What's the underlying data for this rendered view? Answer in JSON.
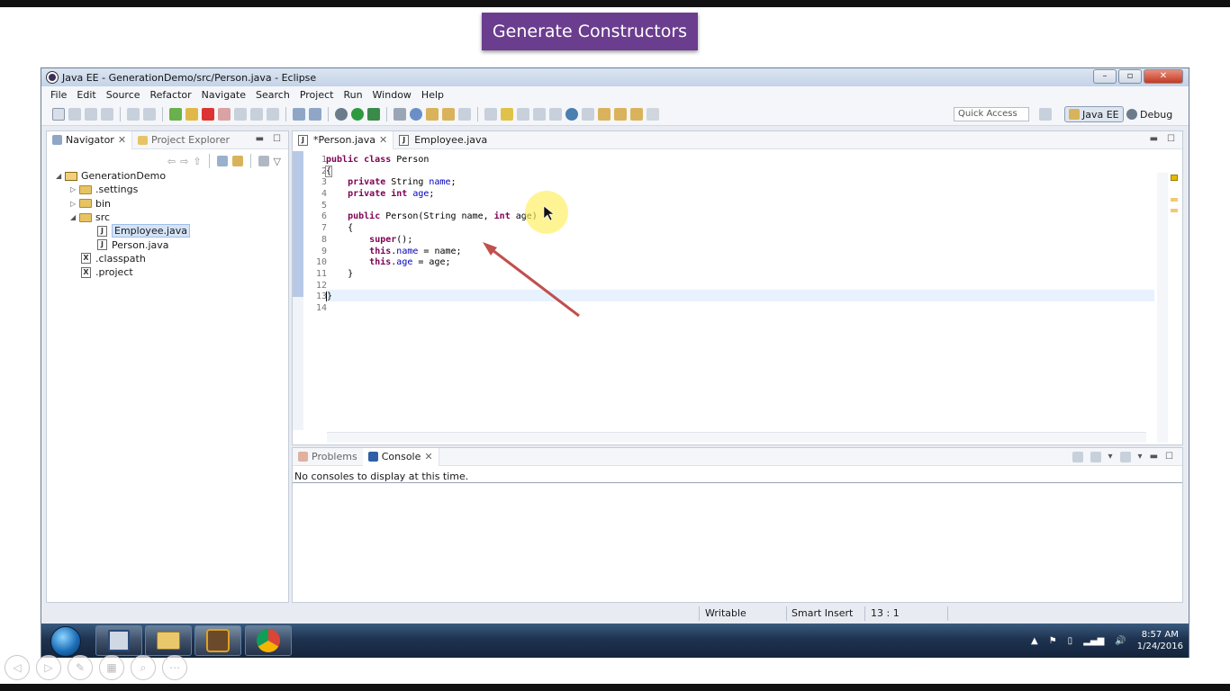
{
  "slide": {
    "title": "Generate Constructors"
  },
  "window": {
    "title": "Java EE - GenerationDemo/src/Person.java - Eclipse",
    "controls": {
      "minimize": "–",
      "maximize": "▫",
      "close": "✕"
    }
  },
  "menu": [
    "File",
    "Edit",
    "Source",
    "Refactor",
    "Navigate",
    "Search",
    "Project",
    "Run",
    "Window",
    "Help"
  ],
  "toolbar": {
    "quick_access_placeholder": "Quick Access",
    "perspectives": {
      "java_ee": "Java EE",
      "debug": "Debug"
    }
  },
  "navigator": {
    "tabs": {
      "navigator": "Navigator",
      "project_explorer": "Project Explorer"
    },
    "tree": {
      "project": "GenerationDemo",
      "settings": ".settings",
      "bin": "bin",
      "src": "src",
      "employee": "Employee.java",
      "person": "Person.java",
      "classpath": ".classpath",
      "dotproject": ".project"
    }
  },
  "editor": {
    "tabs": {
      "person": "*Person.java",
      "employee": "Employee.java"
    },
    "line_numbers": [
      "1",
      "2",
      "3",
      "4",
      "5",
      "6",
      "7",
      "8",
      "9",
      "10",
      "11",
      "12",
      "13",
      "14"
    ],
    "cursor": {
      "line": 13,
      "column": 1
    }
  },
  "console": {
    "tabs": {
      "problems": "Problems",
      "console": "Console"
    },
    "message": "No consoles to display at this time."
  },
  "status": {
    "writable": "Writable",
    "insert_mode": "Smart Insert",
    "position": "13 : 1"
  },
  "taskbar": {
    "time": "8:57 AM",
    "date": "1/24/2016"
  },
  "colors": {
    "slide_title_bg": "#6b3d8f",
    "keyword": "#7f0055",
    "field": "#0000c0",
    "annotation_arrow": "#c0504d"
  }
}
